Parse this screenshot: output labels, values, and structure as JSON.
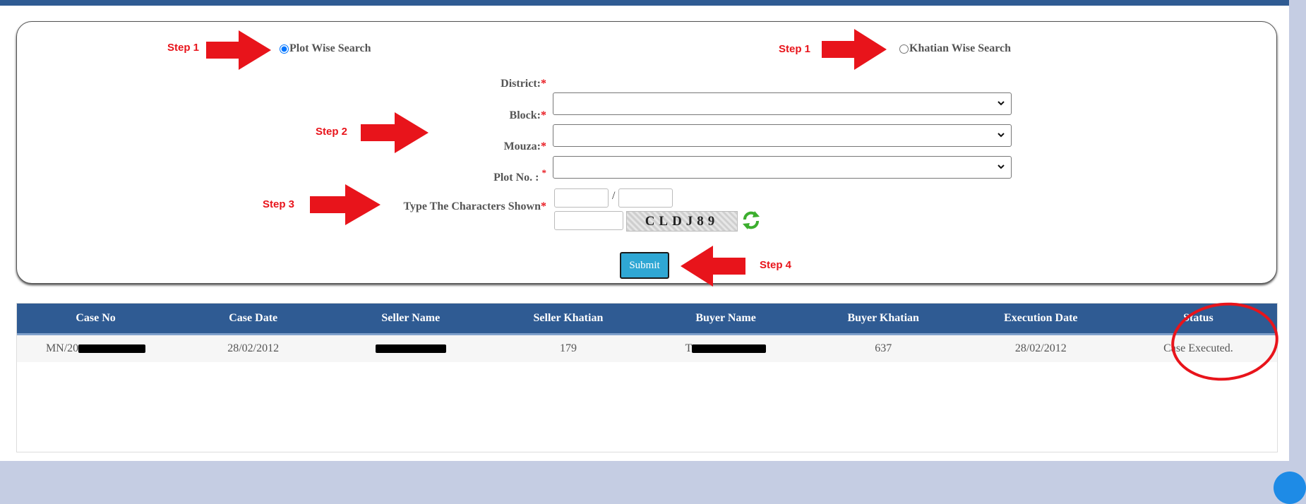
{
  "search_form": {
    "options": [
      {
        "label": "Plot Wise Search",
        "step": "Step 1",
        "checked": true
      },
      {
        "label": "Khatian Wise Search",
        "step": "Step 1",
        "checked": false
      }
    ],
    "fields": {
      "district_label": "District:",
      "block_label": "Block:",
      "mouza_label": "Mouza:",
      "plot_label": "Plot No. :",
      "captcha_label": "Type The Characters Shown",
      "required_mark": "*",
      "plot_separator": "/"
    },
    "captcha_text": "CLDJ89",
    "submit_label": "Submit",
    "steps": {
      "step2": "Step 2",
      "step3": "Step 3",
      "step4": "Step 4"
    }
  },
  "results_table": {
    "columns": [
      "Case No",
      "Case Date",
      "Seller Name",
      "Seller Khatian",
      "Buyer Name",
      "Buyer Khatian",
      "Execution Date",
      "Status"
    ],
    "rows": [
      {
        "case_no_prefix": "MN/20",
        "case_date": "28/02/2012",
        "seller_khatian": "179",
        "buyer_name_prefix": "T",
        "buyer_khatian": "637",
        "execution_date": "28/02/2012",
        "status": "Case Executed."
      }
    ]
  },
  "colors": {
    "header_blue": "#2f5b93",
    "annotation_red": "#e8141b",
    "submit_blue": "#2fa7d4"
  }
}
